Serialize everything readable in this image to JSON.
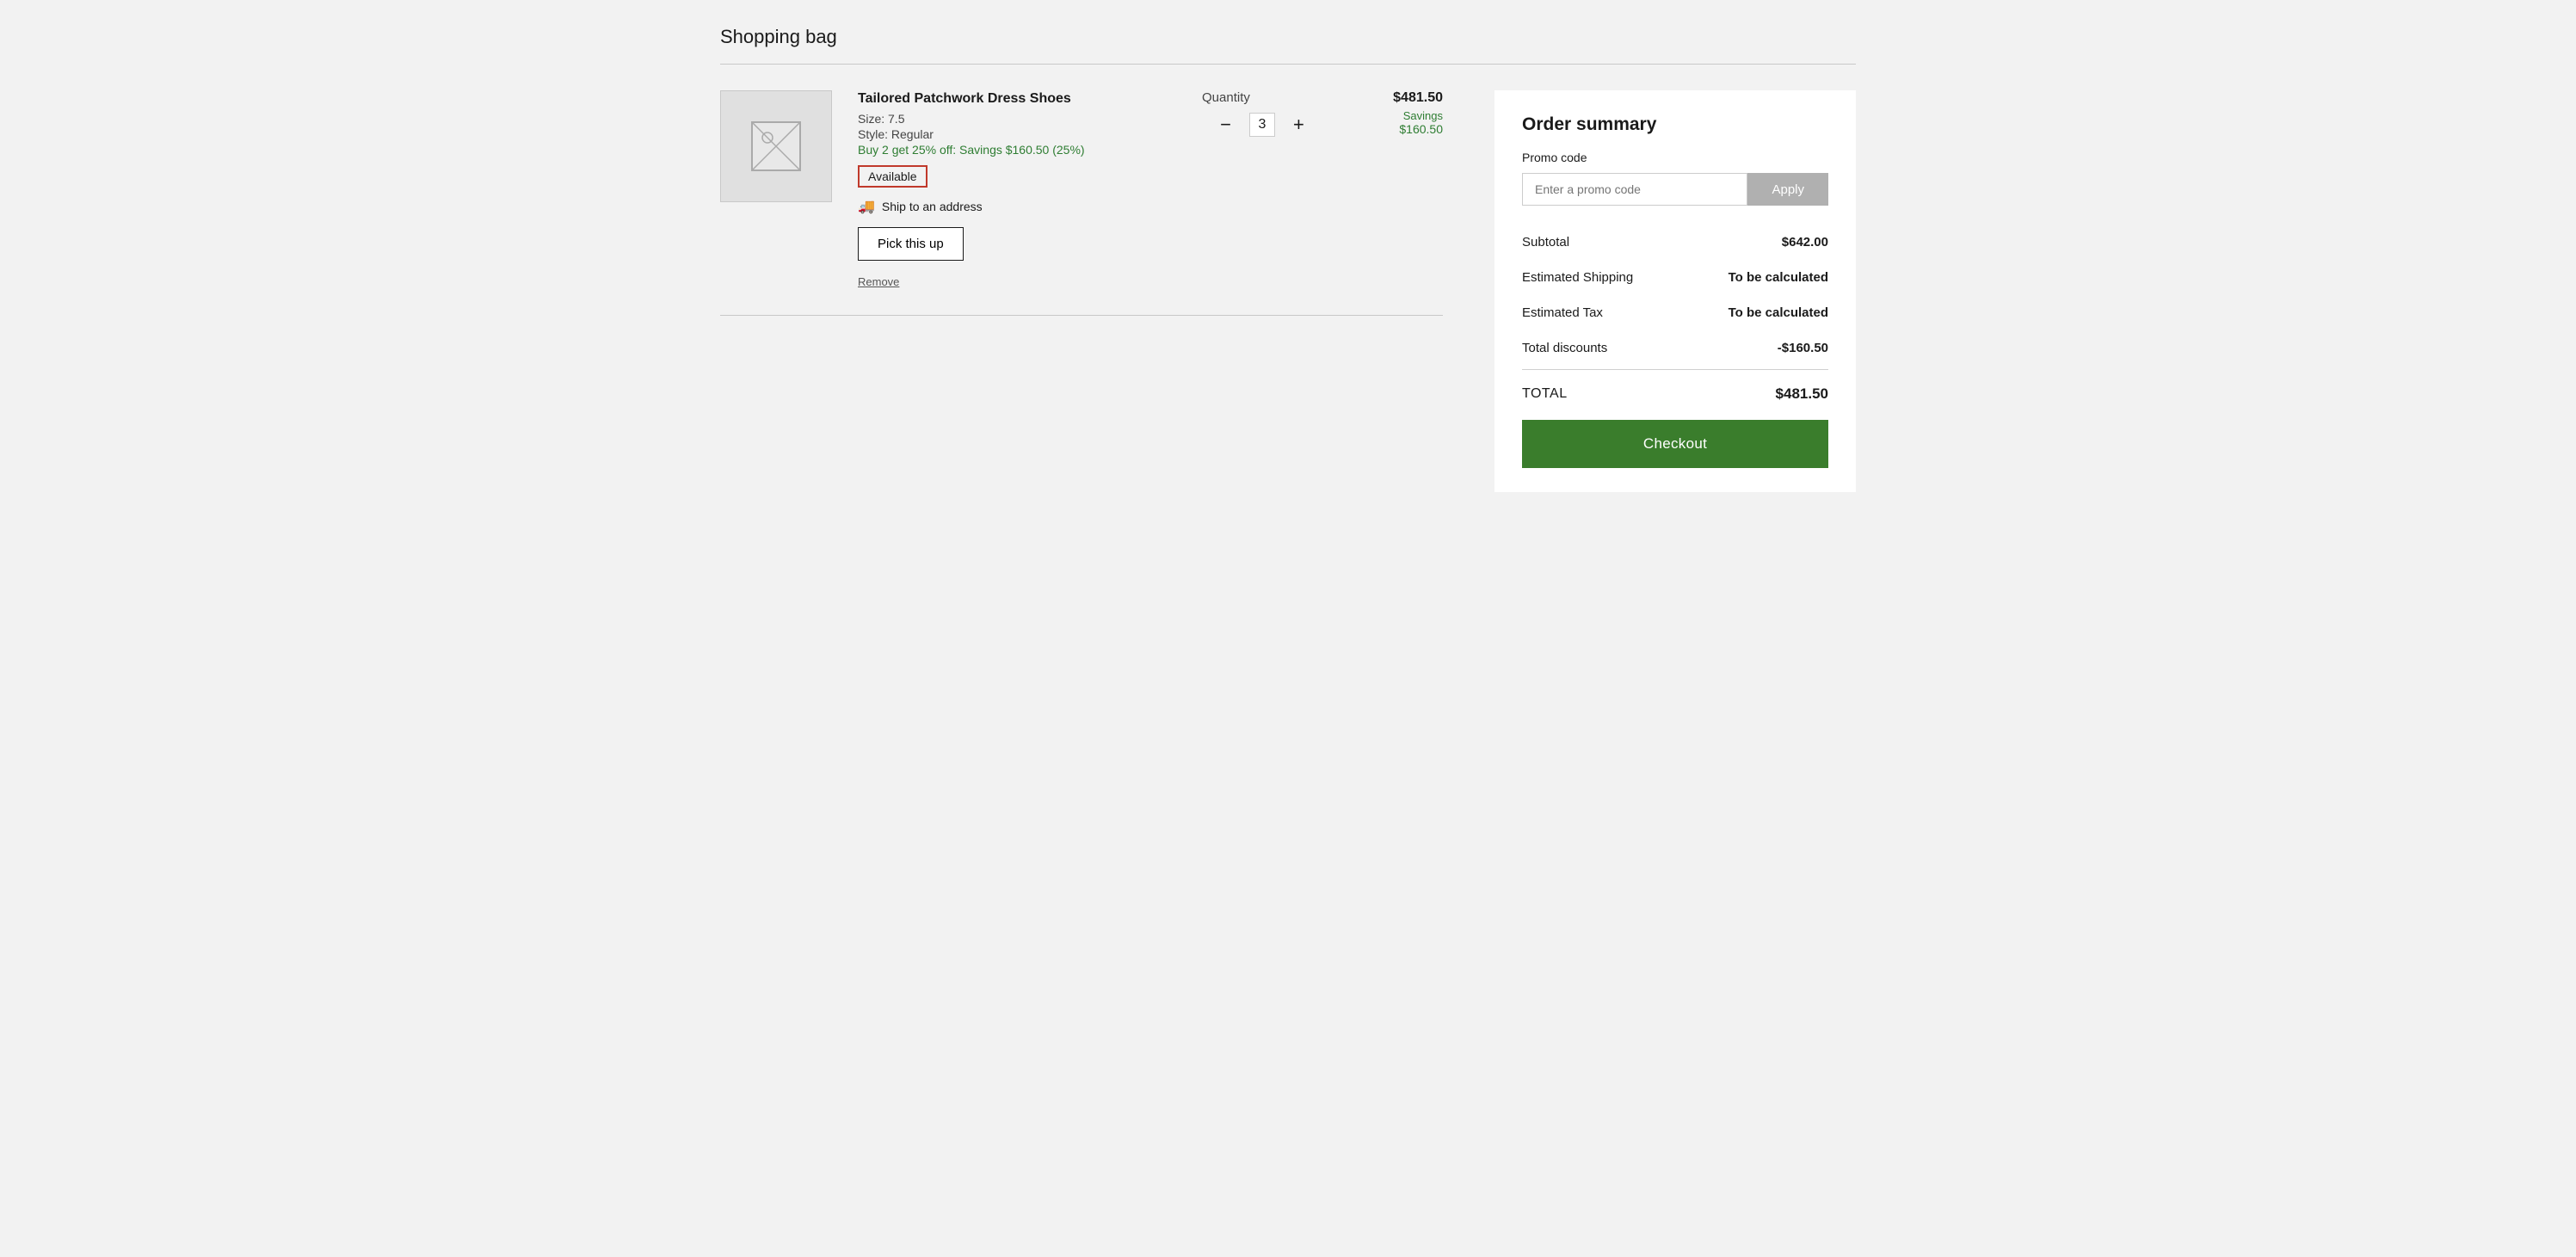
{
  "page": {
    "title": "Shopping bag"
  },
  "cart": {
    "item": {
      "name": "Tailored Patchwork Dress Shoes",
      "size": "Size: 7.5",
      "style": "Style: Regular",
      "promo": "Buy 2 get 25% off: Savings $160.50 (25%)",
      "availability": "Available",
      "ship_option": "Ship to an address",
      "pickup_label": "Pick this up",
      "remove_label": "Remove",
      "quantity_label": "Quantity",
      "quantity": "3",
      "price": "$481.50",
      "savings_label": "Savings",
      "savings_amount": "$160.50"
    }
  },
  "order_summary": {
    "title": "Order summary",
    "promo_code_label": "Promo code",
    "promo_input_placeholder": "Enter a promo code",
    "apply_label": "Apply",
    "subtotal_label": "Subtotal",
    "subtotal_value": "$642.00",
    "shipping_label": "Estimated Shipping",
    "shipping_value": "To be calculated",
    "tax_label": "Estimated Tax",
    "tax_value": "To be calculated",
    "discounts_label": "Total discounts",
    "discounts_value": "-$160.50",
    "total_label": "TOTAL",
    "total_value": "$481.50",
    "checkout_label": "Checkout"
  }
}
